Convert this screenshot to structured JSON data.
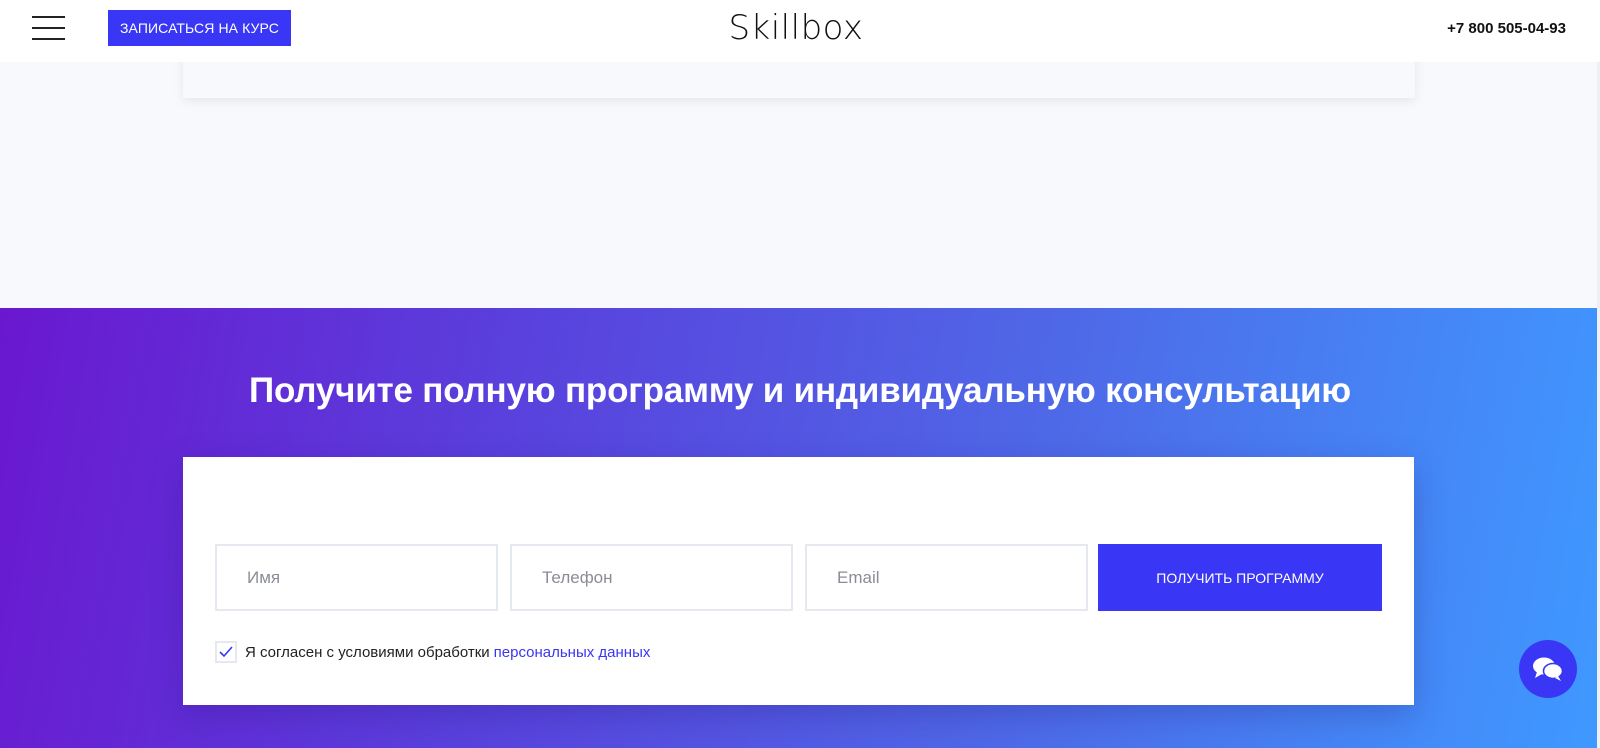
{
  "header": {
    "menu_icon": "hamburger-menu-icon",
    "enroll_label": "ЗАПИСАТЬСЯ НА КУРС",
    "logo_text": "Skillbox",
    "phone": "+7 800 505-04-93"
  },
  "promo": {
    "title": "Получите полную программу и индивидуальную консультацию",
    "form": {
      "name_placeholder": "Имя",
      "phone_placeholder": "Телефон",
      "email_placeholder": "Email",
      "submit_label": "ПОЛУЧИТЬ ПРОГРАММУ",
      "consent_checked": true,
      "consent_text": "Я согласен с условиями обработки",
      "consent_link": "персональных данных"
    }
  },
  "chat": {
    "icon": "chat-bubbles-icon"
  },
  "colors": {
    "accent": "#3a36f5",
    "gradient_start": "#6a18d0",
    "gradient_end": "#3f99ff"
  }
}
